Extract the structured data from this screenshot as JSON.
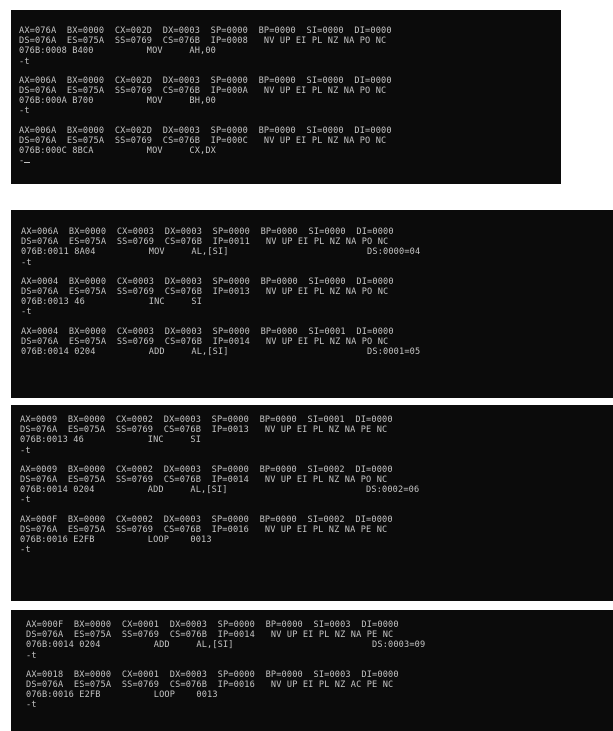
{
  "panels": [
    {
      "blocks": [
        {
          "lines": [
            "AX=076A  BX=0000  CX=002D  DX=0003  SP=0000  BP=0000  SI=0000  DI=0000",
            "DS=076A  ES=075A  SS=0769  CS=076B  IP=0008   NV UP EI PL NZ NA PO NC",
            "076B:0008 B400          MOV     AH,00",
            "-t"
          ]
        },
        {
          "lines": [
            "AX=006A  BX=0000  CX=002D  DX=0003  SP=0000  BP=0000  SI=0000  DI=0000",
            "DS=076A  ES=075A  SS=0769  CS=076B  IP=000A   NV UP EI PL NZ NA PO NC",
            "076B:000A B700          MOV     BH,00",
            "-t"
          ]
        },
        {
          "lines": [
            "AX=006A  BX=0000  CX=002D  DX=0003  SP=0000  BP=0000  SI=0000  DI=0000",
            "DS=076A  ES=075A  SS=0769  CS=076B  IP=000C   NV UP EI PL NZ NA PO NC",
            "076B:000C 8BCA          MOV     CX,DX",
            "-"
          ]
        }
      ]
    },
    {
      "blocks": [
        {
          "lines": [
            "AX=006A  BX=0000  CX=0003  DX=0003  SP=0000  BP=0000  SI=0000  DI=0000",
            "DS=076A  ES=075A  SS=0769  CS=076B  IP=0011   NV UP EI PL NZ NA PO NC",
            "076B:0011 8A04          MOV     AL,[SI]                          DS:0000=04",
            "-t"
          ]
        },
        {
          "lines": [
            "AX=0004  BX=0000  CX=0003  DX=0003  SP=0000  BP=0000  SI=0000  DI=0000",
            "DS=076A  ES=075A  SS=0769  CS=076B  IP=0013   NV UP EI PL NZ NA PO NC",
            "076B:0013 46            INC     SI",
            "-t"
          ]
        },
        {
          "lines": [
            "AX=0004  BX=0000  CX=0003  DX=0003  SP=0000  BP=0000  SI=0001  DI=0000",
            "DS=076A  ES=075A  SS=0769  CS=076B  IP=0014   NV UP EI PL NZ NA PO NC",
            "076B:0014 0204          ADD     AL,[SI]                          DS:0001=05"
          ]
        }
      ]
    },
    {
      "blocks": [
        {
          "lines": [
            "AX=0009  BX=0000  CX=0002  DX=0003  SP=0000  BP=0000  SI=0001  DI=0000",
            "DS=076A  ES=075A  SS=0769  CS=076B  IP=0013   NV UP EI PL NZ NA PE NC",
            "076B:0013 46            INC     SI",
            "-t"
          ]
        },
        {
          "lines": [
            "AX=0009  BX=0000  CX=0002  DX=0003  SP=0000  BP=0000  SI=0002  DI=0000",
            "DS=076A  ES=075A  SS=0769  CS=076B  IP=0014   NV UP EI PL NZ NA PO NC",
            "076B:0014 0204          ADD     AL,[SI]                          DS:0002=06",
            "-t"
          ]
        },
        {
          "lines": [
            "AX=000F  BX=0000  CX=0002  DX=0003  SP=0000  BP=0000  SI=0002  DI=0000",
            "DS=076A  ES=075A  SS=0769  CS=076B  IP=0016   NV UP EI PL NZ NA PE NC",
            "076B:0016 E2FB          LOOP    0013",
            "-t"
          ]
        }
      ]
    },
    {
      "blocks": [
        {
          "lines": [
            "AX=000F  BX=0000  CX=0001  DX=0003  SP=0000  BP=0000  SI=0003  DI=0000",
            "DS=076A  ES=075A  SS=0769  CS=076B  IP=0014   NV UP EI PL NZ NA PE NC",
            "076B:0014 0204          ADD     AL,[SI]                          DS:0003=09",
            "-t"
          ]
        },
        {
          "lines": [
            "AX=0018  BX=0000  CX=0001  DX=0003  SP=0000  BP=0000  SI=0003  DI=0000",
            "DS=076A  ES=075A  SS=0769  CS=076B  IP=0016   NV UP EI PL NZ AC PE NC",
            "076B:0016 E2FB          LOOP    0013",
            "-t"
          ]
        }
      ]
    }
  ]
}
